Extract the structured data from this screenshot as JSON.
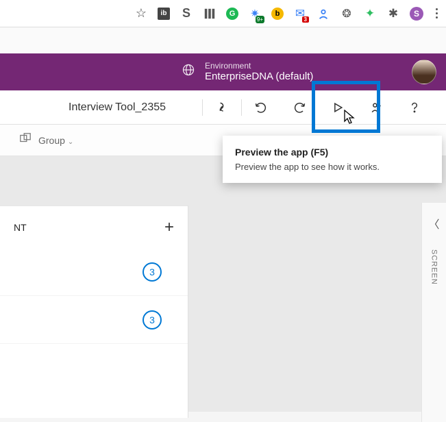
{
  "browser": {
    "extensions": {
      "avatar_letter": "S"
    }
  },
  "header": {
    "environment_label": "Environment",
    "environment_name": "EnterpriseDNA (default)"
  },
  "command_bar": {
    "app_name": "Interview Tool_2355"
  },
  "sub_toolbar": {
    "group_label": "Group"
  },
  "tooltip": {
    "title": "Preview the app (F5)",
    "body": "Preview the app to see how it works."
  },
  "left_panel": {
    "title_fragment": "NT",
    "counts": [
      "3",
      "3"
    ]
  },
  "right_rail": {
    "label": "SCREEN"
  }
}
